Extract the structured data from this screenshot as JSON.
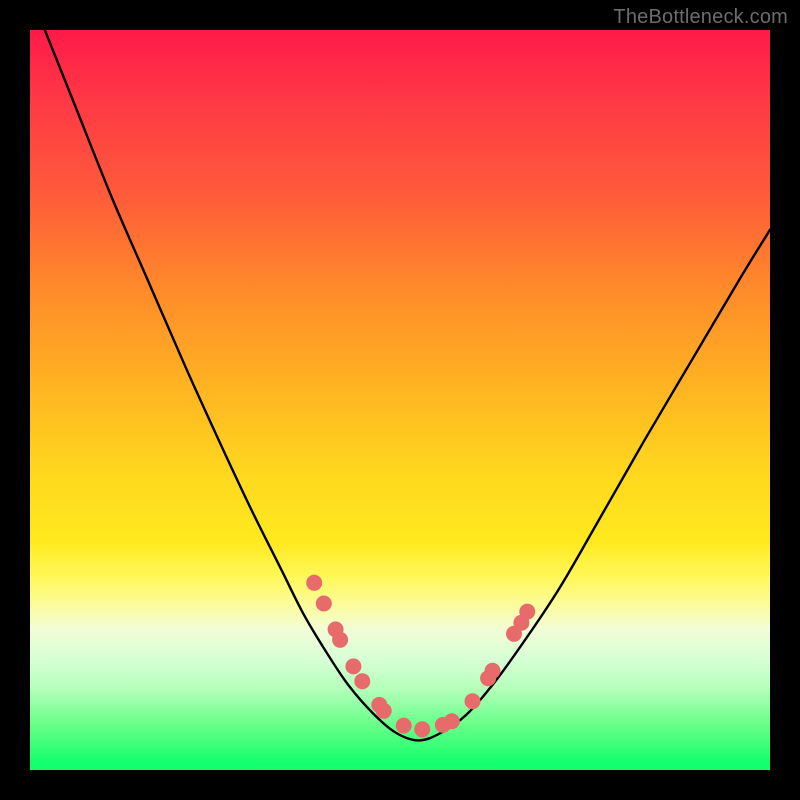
{
  "watermark": "TheBottleneck.com",
  "chart_data": {
    "type": "line",
    "title": "",
    "xlabel": "",
    "ylabel": "",
    "xlim": [
      0,
      1
    ],
    "ylim": [
      0,
      1
    ],
    "series": [
      {
        "name": "curve",
        "x": [
          0.02,
          0.06,
          0.11,
          0.16,
          0.21,
          0.26,
          0.3,
          0.34,
          0.37,
          0.4,
          0.43,
          0.465,
          0.495,
          0.525,
          0.555,
          0.59,
          0.625,
          0.665,
          0.715,
          0.77,
          0.83,
          0.895,
          0.96,
          1.0
        ],
        "y": [
          1.0,
          0.9,
          0.775,
          0.66,
          0.545,
          0.435,
          0.35,
          0.27,
          0.21,
          0.16,
          0.115,
          0.075,
          0.05,
          0.04,
          0.05,
          0.075,
          0.115,
          0.17,
          0.245,
          0.34,
          0.445,
          0.555,
          0.665,
          0.73
        ]
      }
    ],
    "highlighted_points": {
      "name": "dots",
      "coords": [
        [
          0.384,
          0.253
        ],
        [
          0.397,
          0.225
        ],
        [
          0.413,
          0.19
        ],
        [
          0.419,
          0.176
        ],
        [
          0.437,
          0.14
        ],
        [
          0.449,
          0.12
        ],
        [
          0.472,
          0.088
        ],
        [
          0.478,
          0.08
        ],
        [
          0.505,
          0.06
        ],
        [
          0.53,
          0.055
        ],
        [
          0.558,
          0.061
        ],
        [
          0.57,
          0.066
        ],
        [
          0.598,
          0.093
        ],
        [
          0.619,
          0.124
        ],
        [
          0.625,
          0.134
        ],
        [
          0.654,
          0.184
        ],
        [
          0.664,
          0.199
        ],
        [
          0.672,
          0.214
        ]
      ]
    },
    "colors": {
      "curve": "#000000",
      "dots": "#e86b6b"
    }
  }
}
